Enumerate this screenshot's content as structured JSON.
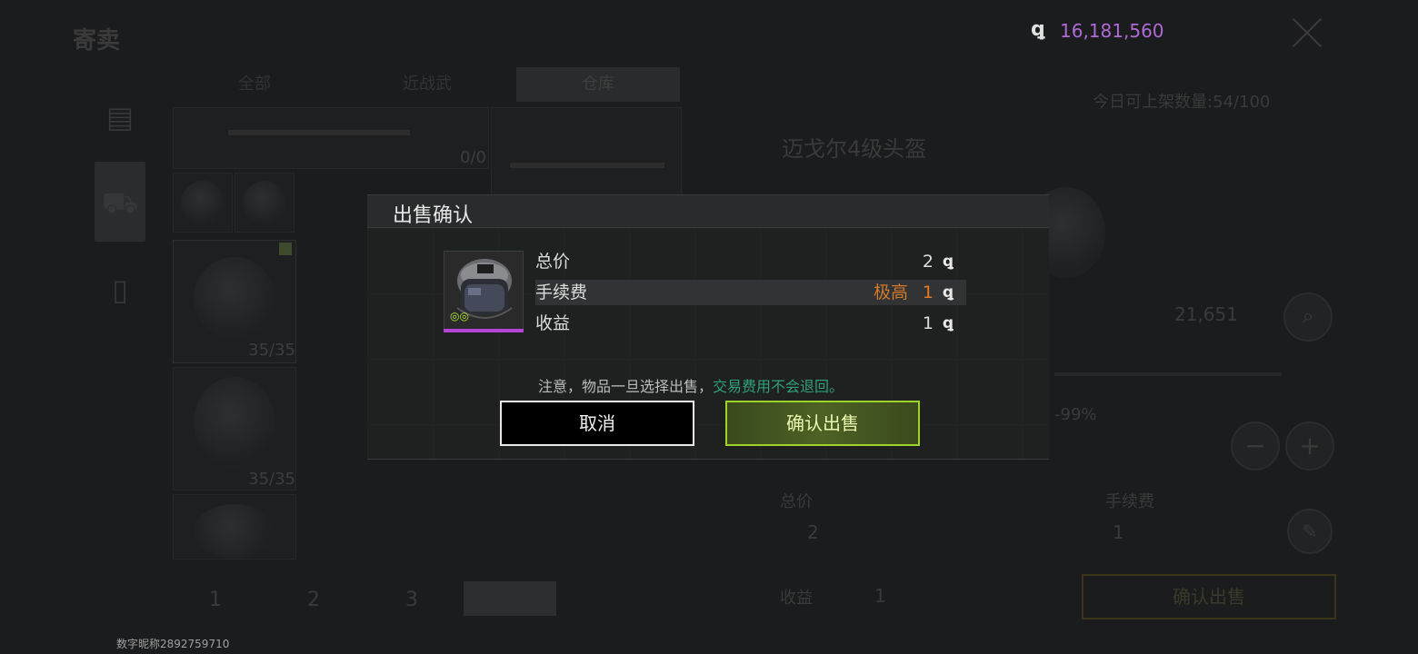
{
  "background": {
    "title": "寄卖",
    "tabs": [
      "全部",
      "近战武",
      "仓库"
    ],
    "slot_counts": [
      "0/0",
      "35/35",
      "35/35"
    ],
    "pages": [
      "1",
      "2",
      "3"
    ],
    "item_name": "迈戈尔4级头盔",
    "daily_limit": "今日可上架数量:54/100",
    "unit_price": "21,651",
    "discount": "-99%",
    "total_label": "总价",
    "total_value": "2",
    "fee_label": "手续费",
    "fee_value": "1",
    "income_label": "收益",
    "income_value": "1",
    "confirm_label": "确认出售",
    "balance_ghost": "16,181,560"
  },
  "topbar": {
    "coin_icon": "coin-icon",
    "balance": "16,181,560"
  },
  "modal": {
    "title": "出售确认",
    "item_icon": "helmet-icon",
    "rows": {
      "total": {
        "label": "总价",
        "value": "2"
      },
      "fee": {
        "label": "手续费",
        "level": "极高",
        "value": "1"
      },
      "income": {
        "label": "收益",
        "value": "1"
      }
    },
    "currency_glyph": "ꝗ",
    "notice_prefix": "注意，物品一旦选择出售，",
    "notice_highlight": "交易费用不会退回。",
    "cancel_label": "取消",
    "confirm_label": "确认出售"
  },
  "footer": {
    "nickname": "数字昵称2892759710"
  },
  "colors": {
    "rarity": "#b445d6",
    "accent_green": "#9ed42a",
    "fee_orange": "#e07a2a",
    "balance_purple": "#b06ad6",
    "notice_green": "#2fa07a"
  }
}
